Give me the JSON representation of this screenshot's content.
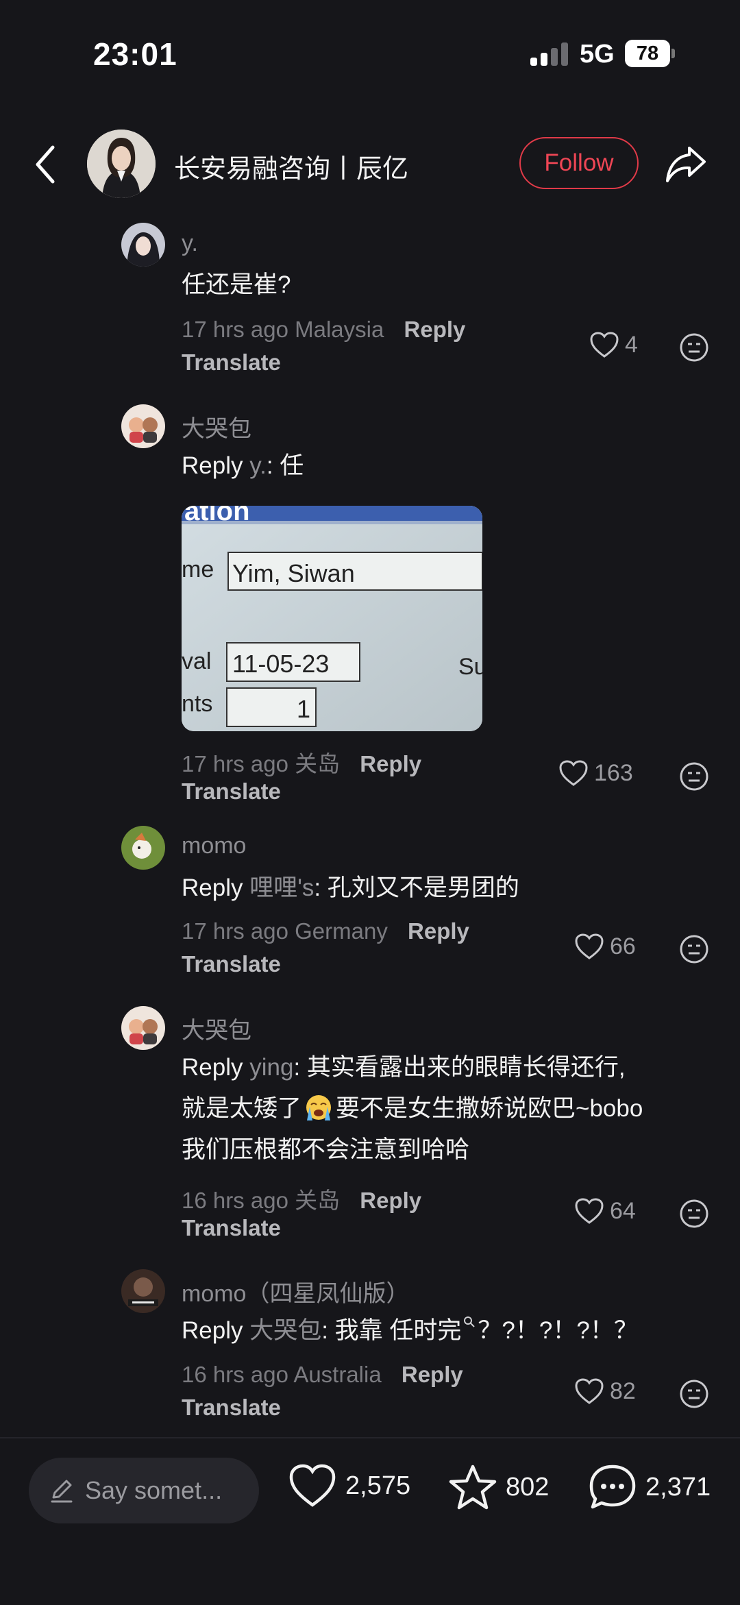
{
  "status_bar": {
    "time": "23:01",
    "network": "5G",
    "battery": "78"
  },
  "header": {
    "author_name": "长安易融咨询丨辰亿",
    "follow_label": "Follow"
  },
  "comments": [
    {
      "username": "y.",
      "text": "任还是崔?",
      "time": "17 hrs ago",
      "location": "Malaysia",
      "reply_label": "Reply",
      "translate_label": "Translate",
      "likes": "4"
    },
    {
      "username": "大哭包",
      "reply_word": "Reply",
      "reply_to": "y.",
      "text": ": 任",
      "time": "17 hrs ago",
      "location": "关岛",
      "reply_label": "Reply",
      "translate_label": "Translate",
      "likes": "163",
      "photo": {
        "heading": "ation",
        "name_label": "me",
        "name_value": "Yim, Siwan",
        "arrival_label": "val",
        "arrival_value": "11-05-23",
        "count_label": "nts",
        "count_value": "1",
        "side_label": "Su"
      }
    },
    {
      "username": "momo",
      "reply_word": "Reply",
      "reply_to": "哩哩's",
      "text": ": 孔刘又不是男团的",
      "time": "17 hrs ago",
      "location": "Germany",
      "reply_label": "Reply",
      "translate_label": "Translate",
      "likes": "66"
    },
    {
      "username": "大哭包",
      "reply_word": "Reply",
      "reply_to": "ying",
      "text_line1": ": 其实看露出来的眼睛长得还行,",
      "text_line2a": "就是太矮了",
      "text_line2b": "要不是女生撒娇说欧巴~bobo",
      "text_line3": "我们压根都不会注意到哈哈",
      "time": "16 hrs ago",
      "location": "关岛",
      "reply_label": "Reply",
      "translate_label": "Translate",
      "likes": "64"
    },
    {
      "username": "momo（四星凤仙版）",
      "reply_word": "Reply",
      "reply_to": "大哭包",
      "text": ": 我靠 任时完",
      "text_tail": "？?！?！?！？",
      "time": "16 hrs ago",
      "location": "Australia",
      "reply_label": "Reply",
      "translate_label": "Translate",
      "likes": "82"
    }
  ],
  "bottom_bar": {
    "input_placeholder": "Say somet...",
    "likes": "2,575",
    "favorites": "802",
    "comments": "2,371"
  },
  "icons": [
    "back-arrow-icon",
    "share-icon",
    "heart-icon",
    "neutral-face-icon",
    "pencil-icon",
    "star-icon",
    "chat-bubble-icon",
    "crying-emoji-icon",
    "signal-icon",
    "battery-icon"
  ],
  "colors": {
    "background": "#16161a",
    "follow": "#ef4655",
    "muted": "#8e8e93"
  }
}
